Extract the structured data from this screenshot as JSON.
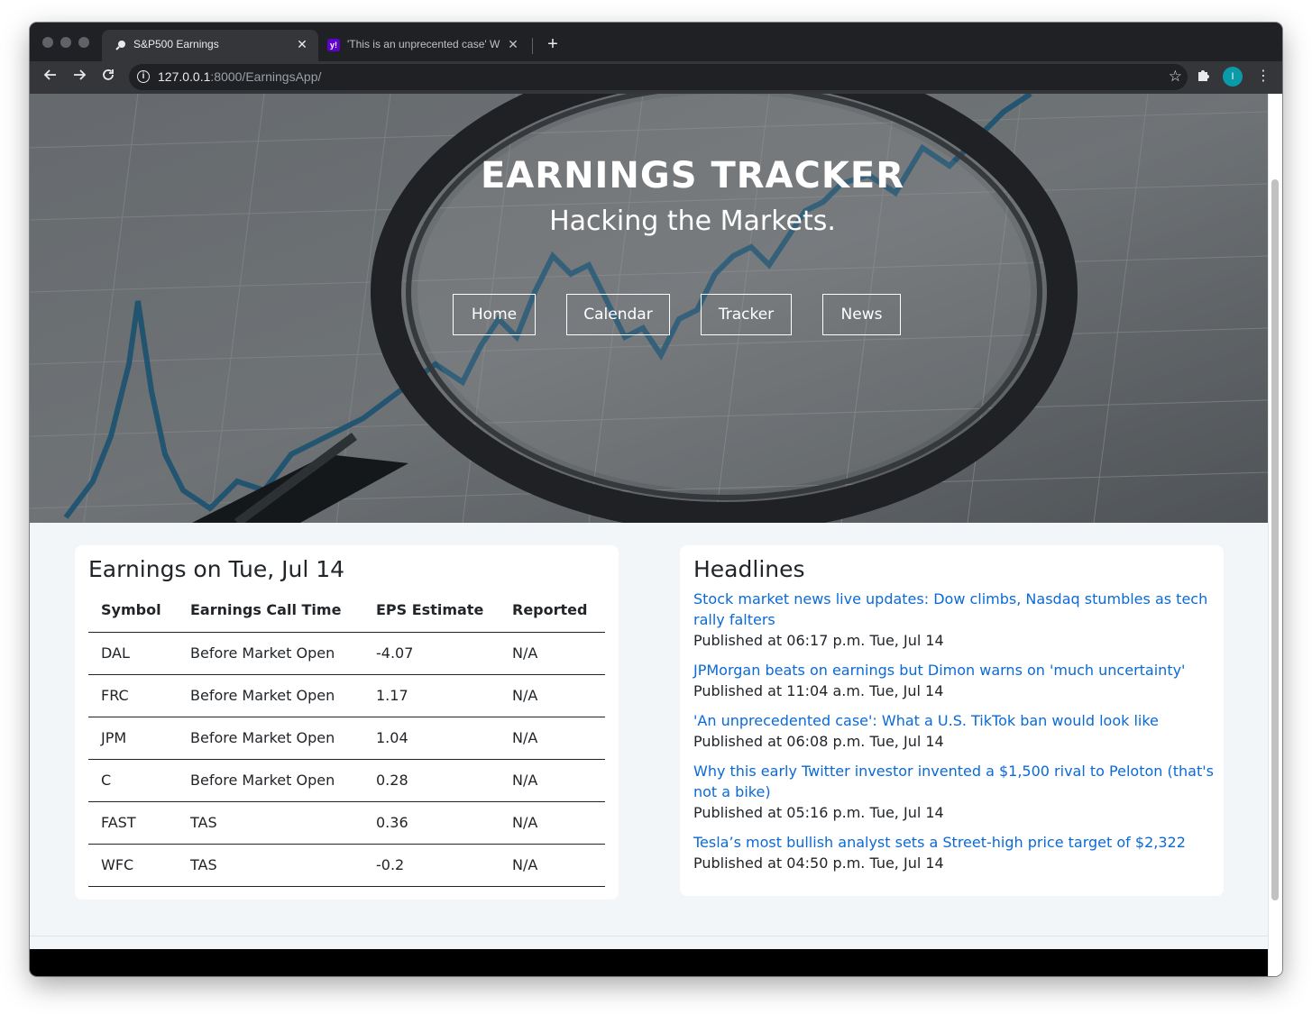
{
  "browser": {
    "tabs": [
      {
        "title": "S&P500 Earnings",
        "active": true
      },
      {
        "title": "'This is an unprecented case' W",
        "active": false
      }
    ],
    "url_host": "127.0.0.1",
    "url_rest": ":8000/EarningsApp/",
    "avatar_letter": "I"
  },
  "hero": {
    "title": "EARNINGS TRACKER",
    "subtitle": "Hacking the Markets.",
    "nav": [
      "Home",
      "Calendar",
      "Tracker",
      "News"
    ]
  },
  "earnings": {
    "title": "Earnings on Tue, Jul 14",
    "headers": [
      "Symbol",
      "Earnings Call Time",
      "EPS Estimate",
      "Reported"
    ],
    "rows": [
      [
        "DAL",
        "Before Market Open",
        "-4.07",
        "N/A"
      ],
      [
        "FRC",
        "Before Market Open",
        "1.17",
        "N/A"
      ],
      [
        "JPM",
        "Before Market Open",
        "1.04",
        "N/A"
      ],
      [
        "C",
        "Before Market Open",
        "0.28",
        "N/A"
      ],
      [
        "FAST",
        "TAS",
        "0.36",
        "N/A"
      ],
      [
        "WFC",
        "TAS",
        "-0.2",
        "N/A"
      ]
    ]
  },
  "headlines": {
    "title": "Headlines",
    "items": [
      {
        "title": "Stock market news live updates: Dow climbs, Nasdaq stumbles as tech rally falters",
        "published": "Published at 06:17 p.m. Tue, Jul 14"
      },
      {
        "title": "JPMorgan beats on earnings but Dimon warns on 'much uncertainty'",
        "published": "Published at 11:04 a.m. Tue, Jul 14"
      },
      {
        "title": "'An unprecedented case': What a U.S. TikTok ban would look like",
        "published": "Published at 06:08 p.m. Tue, Jul 14"
      },
      {
        "title": "Why this early Twitter investor invented a $1,500 rival to Peloton (that's not a bike)",
        "published": "Published at 05:16 p.m. Tue, Jul 14"
      },
      {
        "title": "Tesla’s most bullish analyst sets a Street-high price target of $2,322",
        "published": "Published at 04:50 p.m. Tue, Jul 14"
      }
    ]
  },
  "colors": {
    "link": "#0a6ad6",
    "page_bg": "#f2f6f9",
    "chrome_dark": "#202124"
  }
}
